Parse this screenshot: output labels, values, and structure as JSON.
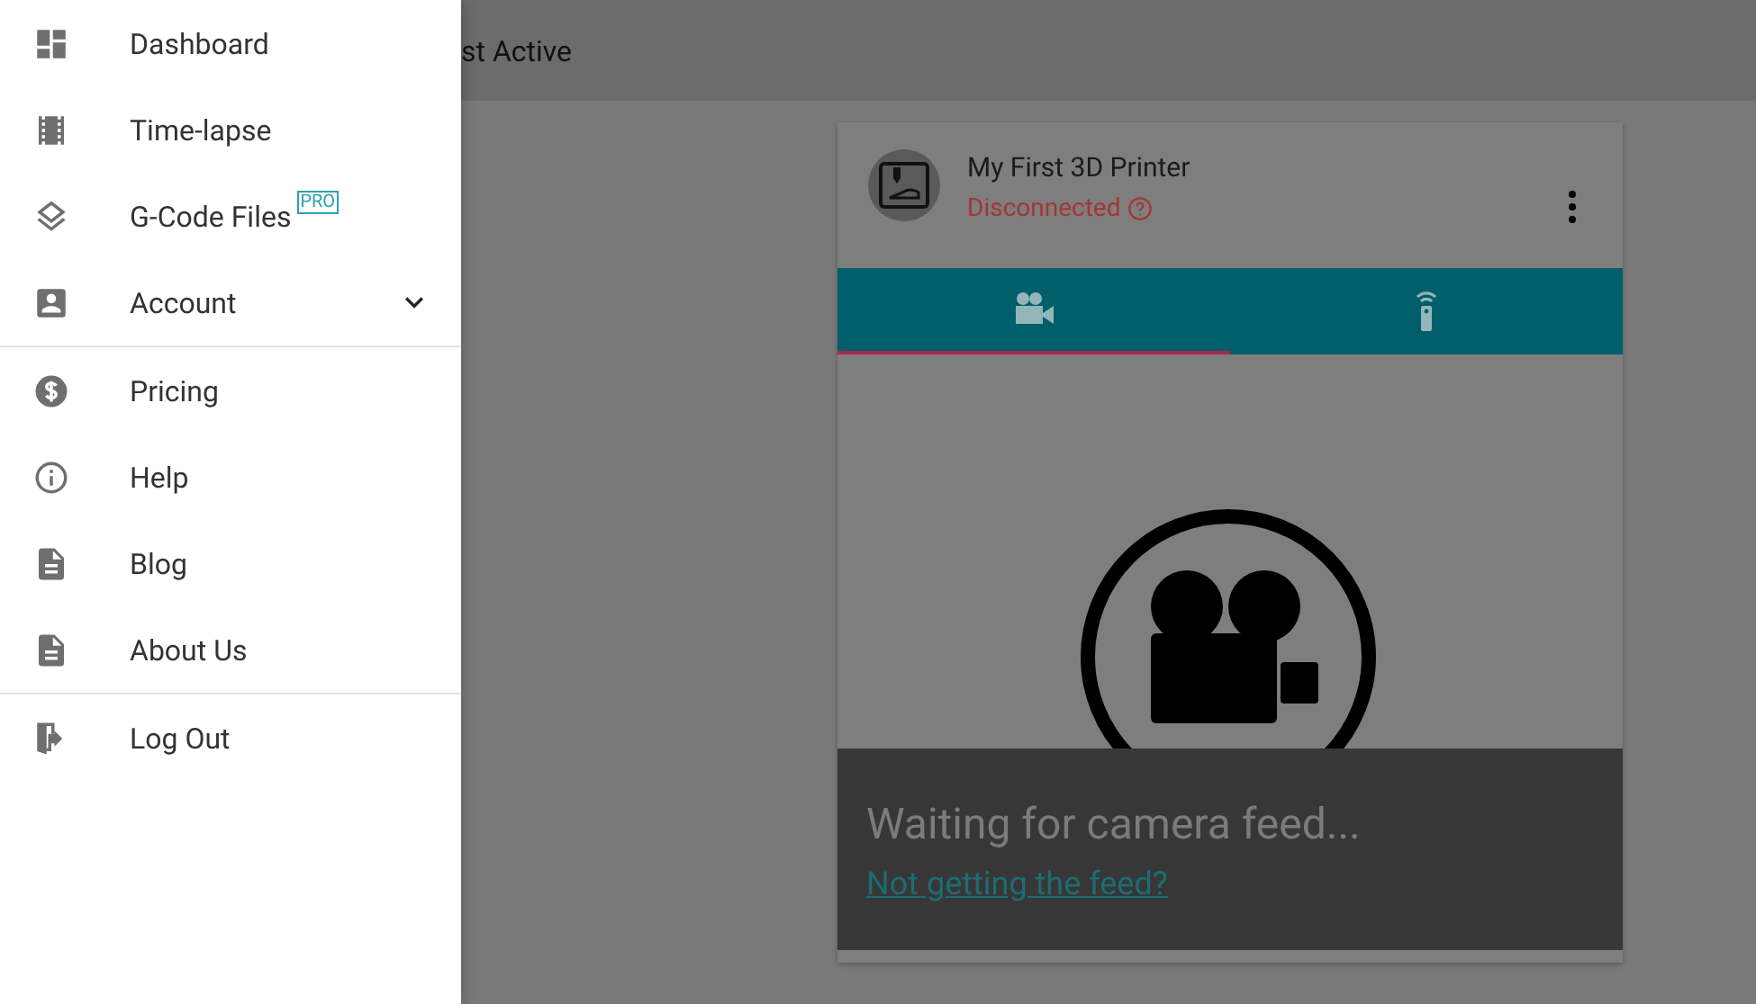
{
  "drawer": {
    "sections": [
      {
        "items": [
          {
            "kind": "link",
            "label": "Dashboard"
          },
          {
            "kind": "link",
            "label": "Time-lapse"
          },
          {
            "kind": "link",
            "label": "G-Code Files",
            "badge": "PRO"
          },
          {
            "kind": "group",
            "label": "Account",
            "expanded": false
          }
        ]
      },
      {
        "items": [
          {
            "kind": "link",
            "label": "Pricing"
          },
          {
            "kind": "link",
            "label": "Help"
          },
          {
            "kind": "link",
            "label": "Blog"
          },
          {
            "kind": "link",
            "label": "About Us"
          }
        ]
      },
      {
        "items": [
          {
            "kind": "link",
            "label": "Log Out"
          }
        ]
      }
    ]
  },
  "top_bar": {
    "title": "st Active"
  },
  "printer_card": {
    "name": "My First 3D Printer",
    "status": "Disconnected",
    "tabs": [
      {
        "selected": true
      },
      {
        "selected": false
      }
    ],
    "camera": {
      "message": "Waiting for camera feed...",
      "link": "Not getting the feed?"
    }
  }
}
